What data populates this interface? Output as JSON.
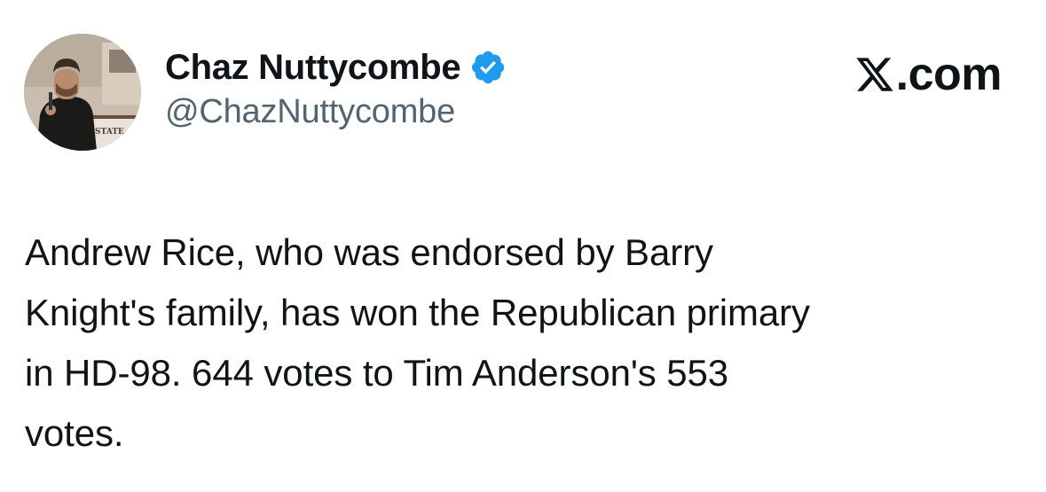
{
  "author": {
    "display_name": "Chaz Nuttycombe",
    "handle": "@ChazNuttycombe",
    "verified": true,
    "avatar_sign_text": "STATE"
  },
  "icons": {
    "avatar": "profile-photo",
    "verified": "verified-badge-icon",
    "brand": "x-logo-icon"
  },
  "brand": {
    "domain": ".com"
  },
  "tweet": {
    "text": "Andrew Rice, who was endorsed by Barry\nKnight's family, has won the Republican primary\nin HD-98. 644 votes to Tim Anderson's 553\nvotes."
  },
  "colors": {
    "text": "#0f1419",
    "secondary_text": "#536471",
    "verified_blue": "#1d9bf0",
    "background": "#ffffff"
  }
}
